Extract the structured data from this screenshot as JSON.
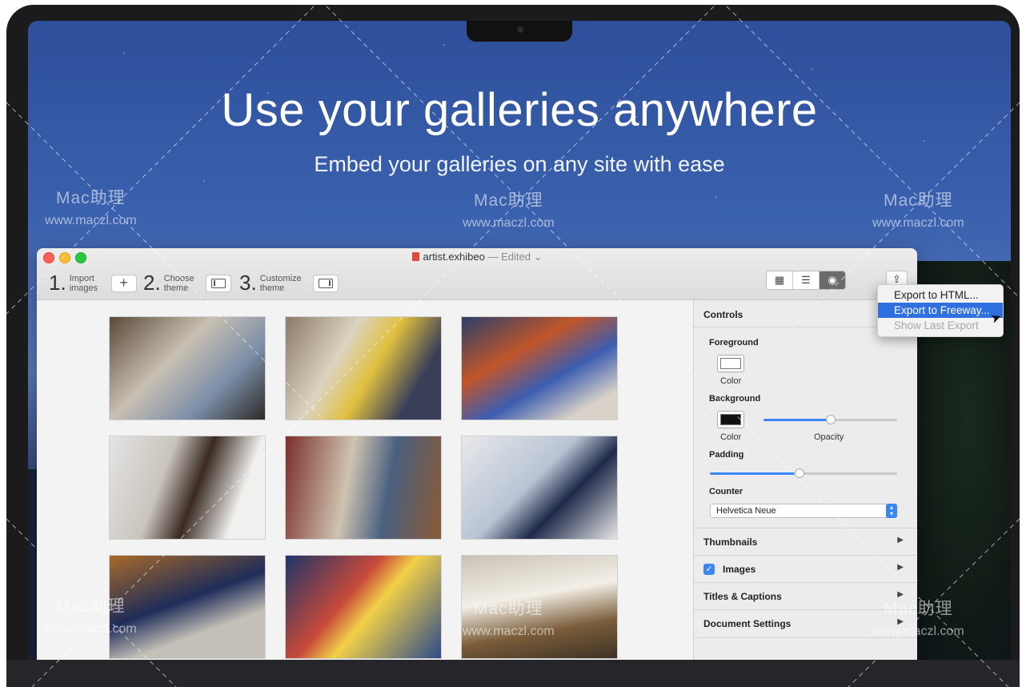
{
  "hero": {
    "title": "Use your galleries anywhere",
    "subtitle": "Embed your galleries on any site with ease"
  },
  "window": {
    "doc_name": "artist.exhibeo",
    "doc_status": "— Edited",
    "status_chevron": "⌄"
  },
  "toolbar": {
    "steps": [
      {
        "num": "1.",
        "label_line1": "Import",
        "label_line2": "images",
        "button_icon": "plus-icon",
        "button_glyph": "+"
      },
      {
        "num": "2.",
        "label_line1": "Choose",
        "label_line2": "theme",
        "button_icon": "sidebar-left-icon"
      },
      {
        "num": "3.",
        "label_line1": "Customize",
        "label_line2": "theme",
        "button_icon": "sidebar-right-icon"
      }
    ],
    "view_modes": [
      "grid-view-icon",
      "list-view-icon",
      "preview-eye-icon"
    ],
    "view_glyphs": [
      "▦",
      "☰",
      "◉"
    ],
    "share_glyph": "⇪"
  },
  "export_menu": {
    "items": [
      {
        "label": "Export to HTML...",
        "state": "normal"
      },
      {
        "label": "Export to Freeway...",
        "state": "highlighted"
      },
      {
        "label": "Show Last Export",
        "state": "disabled"
      }
    ]
  },
  "controls": {
    "header": "Controls",
    "foreground_label": "Foreground",
    "foreground_color_label": "Color",
    "background_label": "Background",
    "background_color_label": "Color",
    "opacity_label": "Opacity",
    "opacity_value": 0.5,
    "padding_label": "Padding",
    "padding_value": 0.48,
    "counter_label": "Counter",
    "counter_font": "Helvetica Neue",
    "sections": [
      {
        "label": "Thumbnails",
        "checkbox": false
      },
      {
        "label": "Images",
        "checkbox": true
      },
      {
        "label": "Titles & Captions",
        "checkbox": false
      },
      {
        "label": "Document Settings",
        "checkbox": false
      }
    ]
  },
  "gallery": {
    "photos": [
      "photo-1",
      "photo-2",
      "photo-3",
      "photo-4",
      "photo-5",
      "photo-6",
      "photo-7",
      "photo-8",
      "photo-9"
    ]
  },
  "watermark": {
    "brand": "Mac助理",
    "url": "www.maczl.com"
  },
  "colors": {
    "accent": "#3b86f7",
    "menu_highlight": "#2f6fe0"
  }
}
